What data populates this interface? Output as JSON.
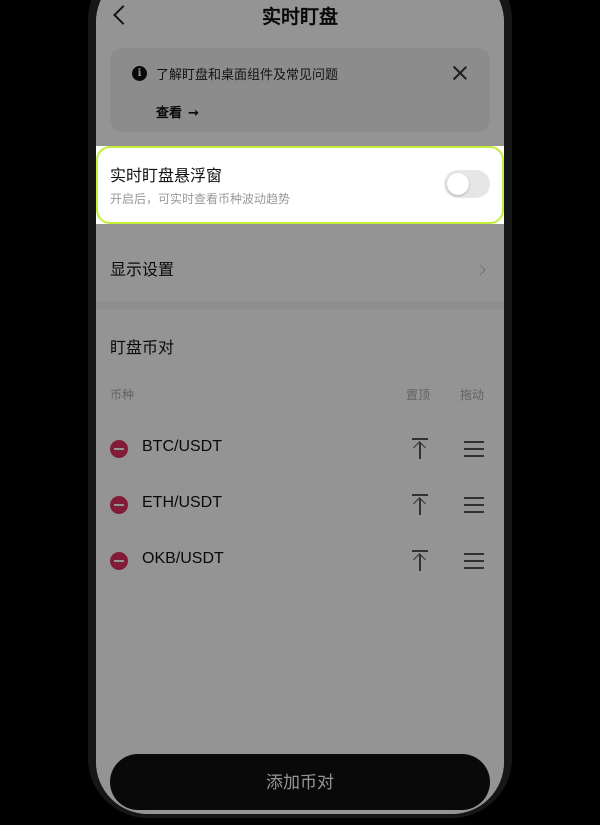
{
  "header": {
    "title": "实时盯盘",
    "back_icon": "chevron-left-icon"
  },
  "info_card": {
    "icon": "info-icon",
    "icon_glyph": "i",
    "text": "了解盯盘和桌面组件及常见问题",
    "link_label": "查看",
    "link_arrow": "→",
    "close_icon": "close-icon"
  },
  "floating_window": {
    "title": "实时盯盘悬浮窗",
    "subtitle": "开启后，可实时查看币种波动趋势",
    "toggle_on": false,
    "highlight_color": "#c4f03a"
  },
  "display_settings": {
    "label": "显示设置"
  },
  "pairs_section": {
    "title": "盯盘币对",
    "columns": {
      "coin": "币种",
      "pin_top": "置顶",
      "drag": "拖动"
    },
    "items": [
      {
        "name": "BTC/USDT"
      },
      {
        "name": "ETH/USDT"
      },
      {
        "name": "OKB/USDT"
      }
    ]
  },
  "footer": {
    "add_button_label": "添加币对"
  },
  "colors": {
    "remove_red": "#e0315a",
    "button_dark": "#111111",
    "background": "#000000"
  }
}
